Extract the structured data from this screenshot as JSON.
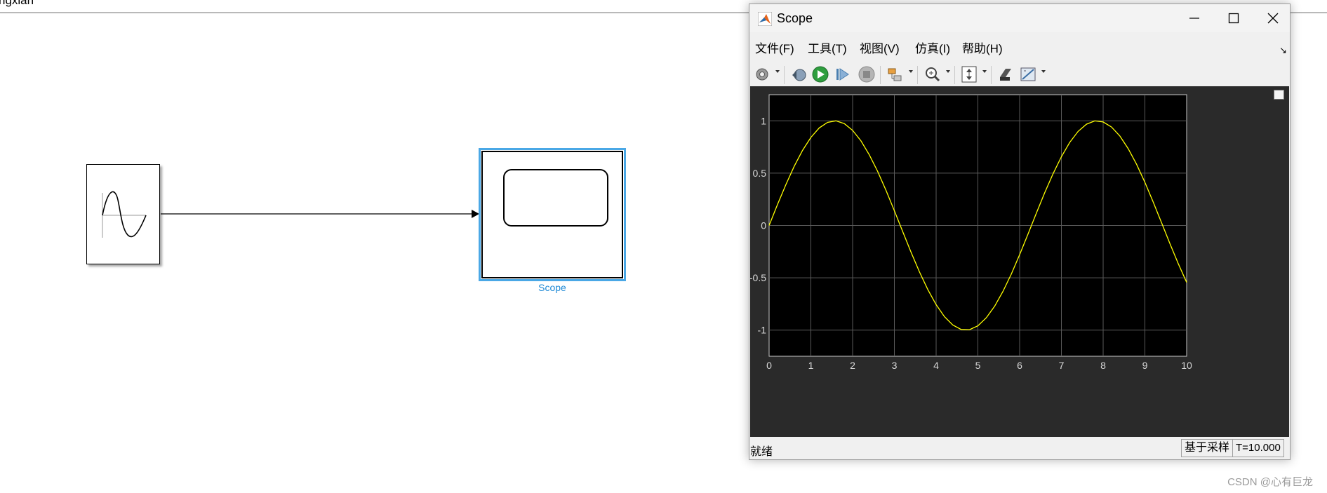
{
  "model": {
    "title_fragment": "ngxian",
    "scope_block_label": "Scope"
  },
  "scope_window": {
    "title": "Scope",
    "menu": [
      "文件(F)",
      "工具(T)",
      "视图(V)",
      "仿真(I)",
      "帮助(H)"
    ],
    "toolbar_icons": [
      "gear-icon",
      "step-back-icon",
      "run-icon",
      "step-forward-icon",
      "stop-icon",
      "signal-selector-icon",
      "zoom-icon",
      "scale-axes-icon",
      "highlight-simulink-block-icon",
      "measurements-icon"
    ],
    "status": {
      "text": "就绪",
      "sample_mode": "基于采样",
      "time": "T=10.000"
    }
  },
  "chart_data": {
    "type": "line",
    "title": "",
    "xlabel": "",
    "ylabel": "",
    "xlim": [
      0,
      10
    ],
    "ylim": [
      -1.25,
      1.25
    ],
    "xticks": [
      0,
      1,
      2,
      3,
      4,
      5,
      6,
      7,
      8,
      9,
      10
    ],
    "yticks": [
      1,
      0.5,
      0,
      -0.5,
      -1
    ],
    "ytick_labels": [
      "1",
      "0.5",
      "0",
      "-0.5",
      "-1"
    ],
    "grid": true,
    "background": "#000000",
    "series": [
      {
        "color": "#ffff00",
        "x": [
          0,
          0.2,
          0.4,
          0.6,
          0.8,
          1.0,
          1.2,
          1.4,
          1.6,
          1.8,
          2.0,
          2.2,
          2.4,
          2.6,
          2.8,
          3.0,
          3.2,
          3.4,
          3.6,
          3.8,
          4.0,
          4.2,
          4.4,
          4.6,
          4.8,
          5.0,
          5.2,
          5.4,
          5.6,
          5.8,
          6.0,
          6.2,
          6.4,
          6.6,
          6.8,
          7.0,
          7.2,
          7.4,
          7.6,
          7.8,
          8.0,
          8.2,
          8.4,
          8.6,
          8.8,
          9.0,
          9.2,
          9.4,
          9.6,
          9.8,
          10.0
        ],
        "y": [
          0,
          0.199,
          0.389,
          0.565,
          0.717,
          0.841,
          0.932,
          0.985,
          1.0,
          0.974,
          0.909,
          0.808,
          0.675,
          0.516,
          0.335,
          0.141,
          -0.058,
          -0.256,
          -0.443,
          -0.612,
          -0.757,
          -0.872,
          -0.952,
          -0.994,
          -0.996,
          -0.959,
          -0.883,
          -0.773,
          -0.631,
          -0.465,
          -0.279,
          -0.083,
          0.117,
          0.312,
          0.494,
          0.657,
          0.794,
          0.899,
          0.968,
          0.999,
          0.989,
          0.941,
          0.855,
          0.734,
          0.585,
          0.412,
          0.223,
          0.025,
          -0.174,
          -0.366,
          -0.544
        ]
      }
    ]
  },
  "watermark": "CSDN @心有巨龙"
}
